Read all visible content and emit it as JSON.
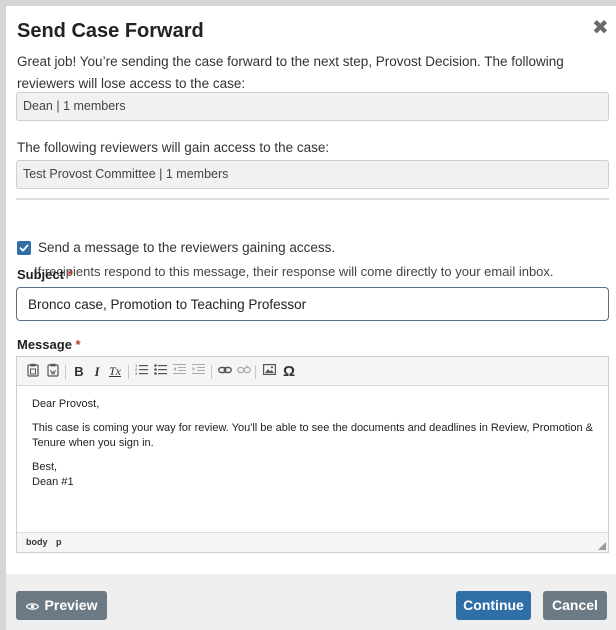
{
  "dialog": {
    "title": "Send Case Forward",
    "intro": "Great job! You’re sending the case forward to the next step, Provost Decision. The following reviewers will lose access to the case:",
    "losing_reviewers": "Dean | 1 members",
    "gain_label": "The following reviewers will gain access to the case:",
    "gaining_reviewers": "Test Provost Committee | 1 members"
  },
  "message_option": {
    "checked": true,
    "label": "Send a message to the reviewers gaining access.",
    "hint": "If recipients respond to this message, their response will come directly to your email inbox."
  },
  "subject": {
    "label": "Subject",
    "required_mark": "*",
    "value": "Bronco case, Promotion to Teaching Professor"
  },
  "message": {
    "label": "Message",
    "required_mark": "*",
    "toolbar": {
      "bold": "B",
      "italic": "I",
      "remove_format": "Tx",
      "special_char": "Ω"
    },
    "body": {
      "greeting": "Dear Provost,",
      "paragraph": "This case is coming your way for review. You'll be able to see the documents and deadlines in Review, Promotion & Tenure when you sign in.",
      "closing": "Best,",
      "signature": "Dean #1"
    },
    "status_path": [
      "body",
      "p"
    ]
  },
  "footer": {
    "preview_label": "Preview",
    "continue_label": "Continue",
    "cancel_label": "Cancel"
  },
  "colors": {
    "primary": "#2f6ea7",
    "secondary": "#6c7a86",
    "required": "#c0392b"
  }
}
